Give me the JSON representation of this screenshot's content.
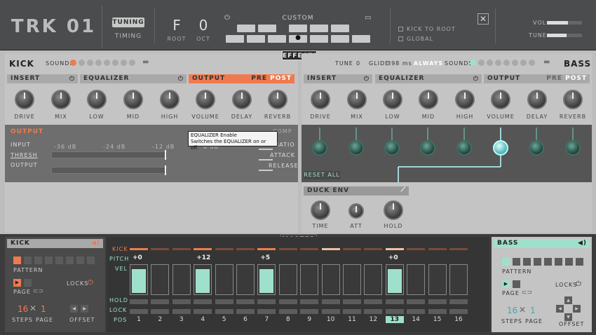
{
  "header": {
    "logo": "TRK 01",
    "tabs": [
      "TUNING",
      "TIMING"
    ],
    "root_value": "F",
    "root_label": "ROOT",
    "oct_value": "0",
    "oct_label": "OCT",
    "scale_title": "CUSTOM",
    "kick_to_root": "KICK TO ROOT",
    "global": "GLOBAL",
    "close": "✕",
    "vol_label": "VOL",
    "tune_label": "TUNE",
    "vol_level": 0.6,
    "tune_level": 0.55
  },
  "effects_tab": "EFFECTS",
  "kick": {
    "title": "KICK",
    "sounds_label": "SOUNDS",
    "insert_label": "INSERT",
    "eq_label": "EQUALIZER",
    "output_label": "OUTPUT",
    "pre": "PRE",
    "post": "POST",
    "knobs": [
      "DRIVE",
      "MIX",
      "LOW",
      "MID",
      "HIGH",
      "VOLUME",
      "DELAY",
      "REVERB"
    ],
    "out_title": "OUTPUT",
    "comp": "COMP",
    "input": "INPUT",
    "thresh": "THRESH",
    "output": "OUTPUT",
    "db": [
      "-36 dB",
      "-24 dB",
      "-12 dB",
      "0 dB"
    ],
    "ratio": "RATIO",
    "attack": "ATTACK",
    "release": "RELEASE"
  },
  "tooltip": {
    "line1": "EQUALIZER Enable",
    "line2": "Switches the EQUALIZER on or off."
  },
  "bass": {
    "title": "BASS",
    "tune_label": "TUNE",
    "tune_value": "0",
    "glide_label": "GLIDE",
    "glide_value": "398 ms",
    "always": "ALWAYS",
    "sounds_label": "SOUNDS",
    "insert_label": "INSERT",
    "eq_label": "EQUALIZER",
    "output_label": "OUTPUT",
    "pre": "PRE",
    "post": "POST",
    "knobs": [
      "DRIVE",
      "MIX",
      "LOW",
      "MID",
      "HIGH",
      "VOLUME",
      "DELAY",
      "REVERB"
    ],
    "reset_all": "RESET ALL",
    "duck_env": "DUCK ENV",
    "env_knobs": [
      "TIME",
      "ATT",
      "HOLD"
    ]
  },
  "master_tab": "MASTER",
  "seq_kick": {
    "title": "KICK",
    "pattern": "PATTERN",
    "page": "PAGE",
    "locks": "LOCKS",
    "steps_value": "16",
    "page_value": "1",
    "steps": "STEPS",
    "page_lbl": "PAGE",
    "offset": "OFFSET"
  },
  "seq_bass": {
    "title": "BASS",
    "pattern": "PATTERN",
    "page": "PAGE",
    "locks": "LOCKS",
    "steps_value": "16",
    "page_value": "1",
    "steps": "STEPS",
    "page_lbl": "PAGE",
    "offset": "OFFSET"
  },
  "seq": {
    "rows": [
      "KICK",
      "PITCH",
      "VEL",
      "HOLD",
      "LOCK",
      "POS"
    ],
    "pitch": [
      "+0",
      "+12",
      "+5",
      "+0"
    ],
    "positions": [
      "1",
      "2",
      "3",
      "4",
      "5",
      "6",
      "7",
      "8",
      "9",
      "10",
      "11",
      "12",
      "13",
      "14",
      "15",
      "16"
    ],
    "active_pos": "13"
  }
}
